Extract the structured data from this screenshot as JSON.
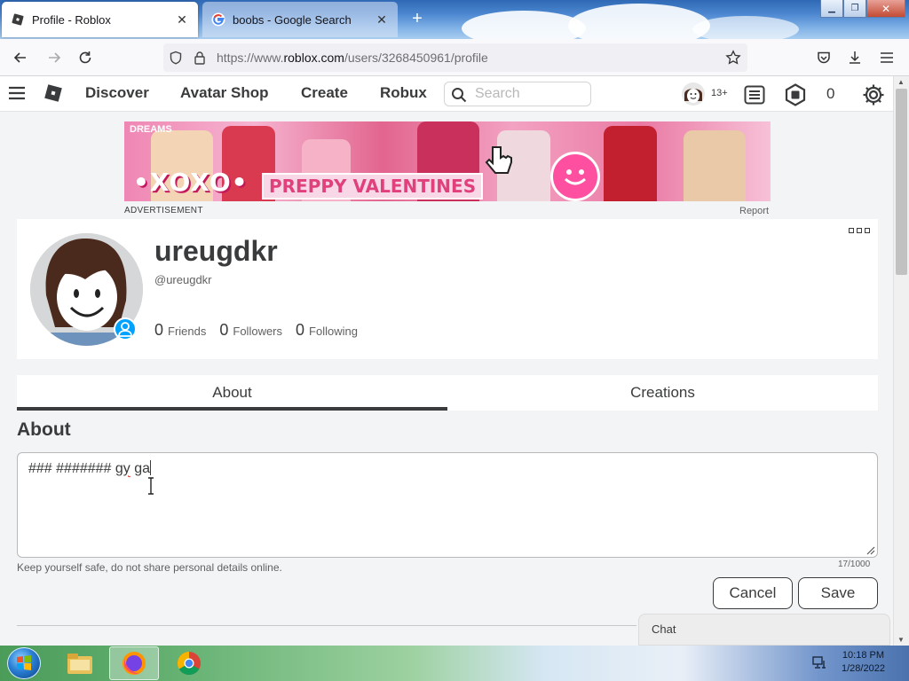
{
  "browser": {
    "tabs": [
      {
        "title": "Profile - Roblox",
        "active": true,
        "favicon": "roblox-icon"
      },
      {
        "title": "boobs - Google Search",
        "active": false,
        "favicon": "google-icon"
      }
    ],
    "new_tab_label": "+",
    "url": {
      "prefix": "https://www.",
      "domain": "roblox.com",
      "path": "/users/3268450961/profile"
    }
  },
  "roblox_header": {
    "nav": [
      "Discover",
      "Avatar Shop",
      "Create",
      "Robux"
    ],
    "search_placeholder": "Search",
    "age_label": "13+",
    "robux_balance": "0"
  },
  "ad": {
    "headline": "•XOXO•",
    "tagline": "PREPPY VALENTINES",
    "corner_text": "DREAMS",
    "label": "ADVERTISEMENT",
    "report": "Report"
  },
  "profile": {
    "display_name": "ureugdkr",
    "username": "@ureugdkr",
    "stats": [
      {
        "count": "0",
        "label": "Friends"
      },
      {
        "count": "0",
        "label": "Followers"
      },
      {
        "count": "0",
        "label": "Following"
      }
    ]
  },
  "profile_tabs": [
    "About",
    "Creations"
  ],
  "about": {
    "title": "About",
    "text_before": "### ####### ",
    "text_misspelled": "gy",
    "text_after": " ga",
    "safety_note": "Keep yourself safe, do not share personal details online.",
    "char_count": "17/1000",
    "cancel_label": "Cancel",
    "save_label": "Save"
  },
  "chat": {
    "label": "Chat"
  },
  "taskbar": {
    "time": "10:18 PM",
    "date": "1/28/2022",
    "pinned": [
      "windows-explorer-icon",
      "firefox-icon",
      "chrome-icon"
    ]
  },
  "colors": {
    "roblox_text": "#393b3d",
    "online_blue": "#00a2ff",
    "page_bg": "#f2f4f5"
  }
}
